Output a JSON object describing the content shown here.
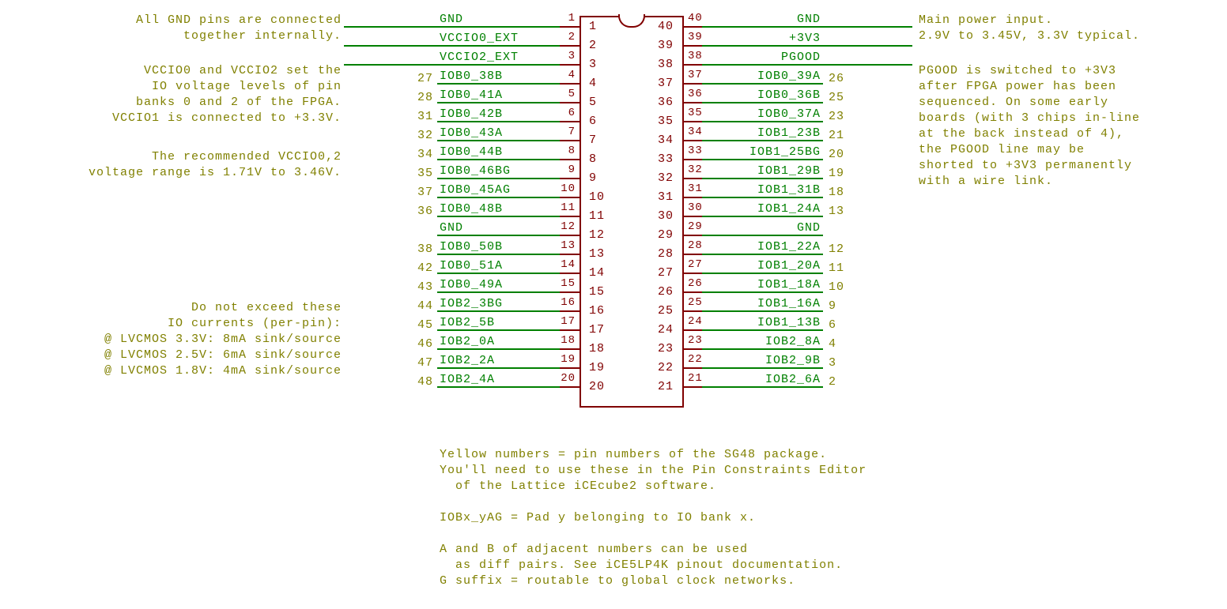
{
  "notes": {
    "left1": "All GND pins are connected\ntogether internally.",
    "left2": "VCCIO0 and VCCIO2 set the\nIO voltage levels of pin\nbanks 0 and 2 of the FPGA.\nVCCIO1 is connected to +3.3V.",
    "left3": "The recommended VCCIO0,2\nvoltage range is 1.71V to 3.46V.",
    "left4": "Do not exceed these\nIO currents (per-pin):\n@ LVCMOS 3.3V: 8mA sink/source\n@ LVCMOS 2.5V: 6mA sink/source\n@ LVCMOS 1.8V: 4mA sink/source",
    "right1": "Main power input.\n2.9V to 3.45V, 3.3V typical.",
    "right2": "PGOOD is switched to +3V3\nafter FPGA power has been\nsequenced. On some early\nboards (with 3 chips in-line\nat the back instead of 4),\nthe PGOOD line may be\nshorted to +3V3 permanently\nwith a wire link.",
    "bottom": "Yellow numbers = pin numbers of the SG48 package.\nYou'll need to use these in the Pin Constraints Editor\n  of the Lattice iCEcube2 software.\n\nIOBx_yAG = Pad y belonging to IO bank x.\n\nA and B of adjacent numbers can be used\n  as diff pairs. See iCE5LP4K pinout documentation.\nG suffix = routable to global clock networks."
  },
  "chip": {
    "left_pins": [
      {
        "n": 1,
        "label": "GND",
        "sg48": "",
        "extend": true
      },
      {
        "n": 2,
        "label": "VCCIO0_EXT",
        "sg48": "",
        "extend": true
      },
      {
        "n": 3,
        "label": "VCCIO2_EXT",
        "sg48": "",
        "extend": true
      },
      {
        "n": 4,
        "label": "IOB0_38B",
        "sg48": "27"
      },
      {
        "n": 5,
        "label": "IOB0_41A",
        "sg48": "28"
      },
      {
        "n": 6,
        "label": "IOB0_42B",
        "sg48": "31"
      },
      {
        "n": 7,
        "label": "IOB0_43A",
        "sg48": "32"
      },
      {
        "n": 8,
        "label": "IOB0_44B",
        "sg48": "34"
      },
      {
        "n": 9,
        "label": "IOB0_46BG",
        "sg48": "35"
      },
      {
        "n": 10,
        "label": "IOB0_45AG",
        "sg48": "37"
      },
      {
        "n": 11,
        "label": "IOB0_48B",
        "sg48": "36"
      },
      {
        "n": 12,
        "label": "GND",
        "sg48": ""
      },
      {
        "n": 13,
        "label": "IOB0_50B",
        "sg48": "38"
      },
      {
        "n": 14,
        "label": "IOB0_51A",
        "sg48": "42"
      },
      {
        "n": 15,
        "label": "IOB0_49A",
        "sg48": "43"
      },
      {
        "n": 16,
        "label": "IOB2_3BG",
        "sg48": "44"
      },
      {
        "n": 17,
        "label": "IOB2_5B",
        "sg48": "45"
      },
      {
        "n": 18,
        "label": "IOB2_0A",
        "sg48": "46"
      },
      {
        "n": 19,
        "label": "IOB2_2A",
        "sg48": "47"
      },
      {
        "n": 20,
        "label": "IOB2_4A",
        "sg48": "48"
      }
    ],
    "right_pins": [
      {
        "n": 40,
        "label": "GND",
        "sg48": "",
        "extend": true
      },
      {
        "n": 39,
        "label": "+3V3",
        "sg48": "",
        "extend": true
      },
      {
        "n": 38,
        "label": "PGOOD",
        "sg48": "",
        "extend": true
      },
      {
        "n": 37,
        "label": "IOB0_39A",
        "sg48": "26"
      },
      {
        "n": 36,
        "label": "IOB0_36B",
        "sg48": "25"
      },
      {
        "n": 35,
        "label": "IOB0_37A",
        "sg48": "23"
      },
      {
        "n": 34,
        "label": "IOB1_23B",
        "sg48": "21"
      },
      {
        "n": 33,
        "label": "IOB1_25BG",
        "sg48": "20"
      },
      {
        "n": 32,
        "label": "IOB1_29B",
        "sg48": "19"
      },
      {
        "n": 31,
        "label": "IOB1_31B",
        "sg48": "18"
      },
      {
        "n": 30,
        "label": "IOB1_24A",
        "sg48": "13"
      },
      {
        "n": 29,
        "label": "GND",
        "sg48": ""
      },
      {
        "n": 28,
        "label": "IOB1_22A",
        "sg48": "12"
      },
      {
        "n": 27,
        "label": "IOB1_20A",
        "sg48": "11"
      },
      {
        "n": 26,
        "label": "IOB1_18A",
        "sg48": "10"
      },
      {
        "n": 25,
        "label": "IOB1_16A",
        "sg48": "9"
      },
      {
        "n": 24,
        "label": "IOB1_13B",
        "sg48": "6"
      },
      {
        "n": 23,
        "label": "IOB2_8A",
        "sg48": "4"
      },
      {
        "n": 22,
        "label": "IOB2_9B",
        "sg48": "3"
      },
      {
        "n": 21,
        "label": "IOB2_6A",
        "sg48": "2"
      }
    ]
  }
}
